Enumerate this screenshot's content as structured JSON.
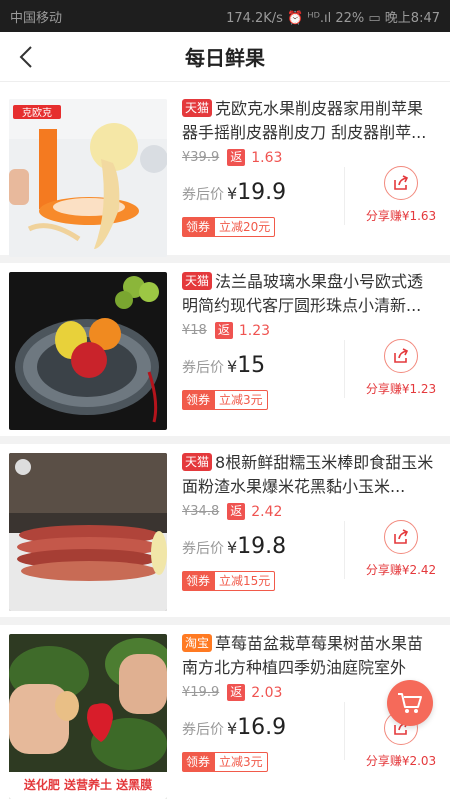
{
  "status_bar": {
    "carrier": "中国移动",
    "right": "174.2K/s ⏰ ᴴᴰ.ıl 22% ▭ 晚上8:47"
  },
  "header": {
    "title": "每日鲜果"
  },
  "products": [
    {
      "shop": "天猫",
      "shop_type": "tmall",
      "name": "克欧克水果削皮器家用削苹果器手摇削皮器削皮刀 刮皮器削苹...",
      "orig_price": "¥39.9",
      "rebate_badge": "返",
      "rebate": "1.63",
      "price_label": "券后价",
      "yen": "¥",
      "price": "19.9",
      "coupon_tag": "领券",
      "coupon_value": "立减20元",
      "share_text": "分享赚¥1.63",
      "thumb_logo": "克欧克"
    },
    {
      "shop": "天猫",
      "shop_type": "tmall",
      "name": "法兰晶玻璃水果盘小号欧式透明简约现代客厅圆形珠点小清新...",
      "orig_price": "¥18",
      "rebate_badge": "返",
      "rebate": "1.23",
      "price_label": "券后价",
      "yen": "¥",
      "price": "15",
      "coupon_tag": "领券",
      "coupon_value": "立减3元",
      "share_text": "分享赚¥1.23"
    },
    {
      "shop": "天猫",
      "shop_type": "tmall",
      "name": "8根新鲜甜糯玉米棒即食甜玉米面粉渣水果爆米花黑黏小玉米...",
      "orig_price": "¥34.8",
      "rebate_badge": "返",
      "rebate": "2.42",
      "price_label": "券后价",
      "yen": "¥",
      "price": "19.8",
      "coupon_tag": "领券",
      "coupon_value": "立减15元",
      "share_text": "分享赚¥2.42"
    },
    {
      "shop": "淘宝",
      "shop_type": "taobao",
      "name": "草莓苗盆栽草莓果树苗水果苗南方北方种植四季奶油庭院室外",
      "orig_price": "¥19.9",
      "rebate_badge": "返",
      "rebate": "2.03",
      "price_label": "券后价",
      "yen": "¥",
      "price": "16.9",
      "coupon_tag": "领券",
      "coupon_value": "立减3元",
      "share_text": "分享赚¥2.03",
      "thumb_caption": "送化肥  送营养土  送黑膜"
    }
  ],
  "icons": {
    "back": "back-arrow-icon",
    "share": "share-icon",
    "cart": "cart-icon"
  },
  "colors": {
    "accent": "#e4393c",
    "tmall": "#e4393c",
    "taobao": "#ff7a22"
  }
}
